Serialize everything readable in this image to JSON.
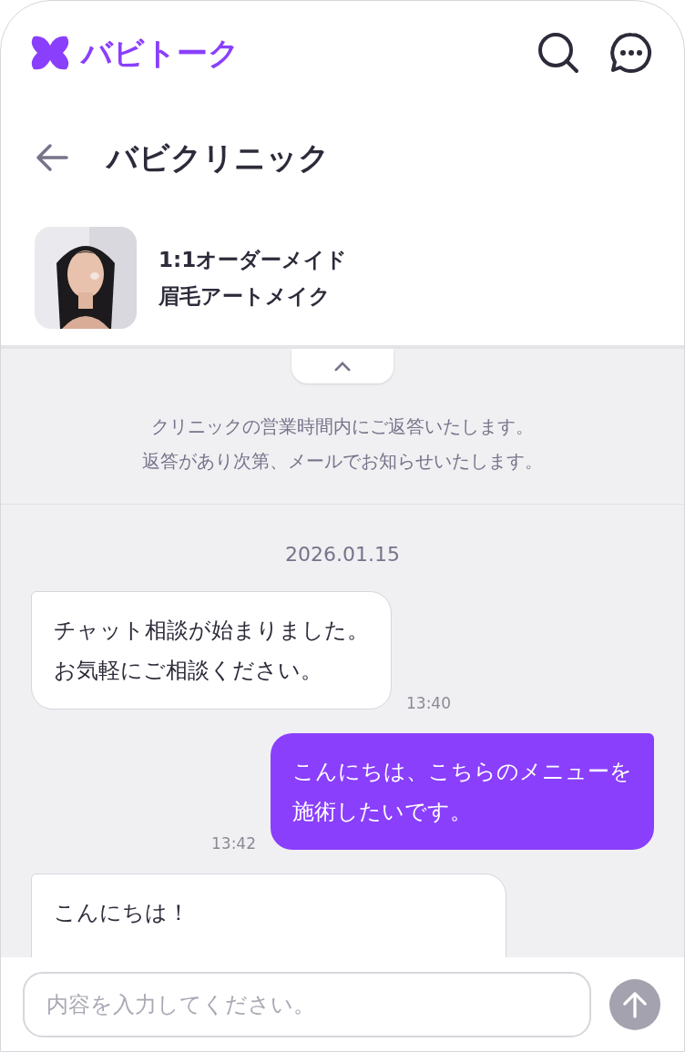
{
  "app": {
    "logo_text": "バビトーク"
  },
  "chat_header": {
    "title": "バビクリニック"
  },
  "product": {
    "image": {
      "kind": "picture"
    },
    "title_lines": [
      "1:1オーダーメイド",
      "眉毛アートメイク"
    ]
  },
  "notice": {
    "lines": [
      "クリニックの営業時間内にご返答いたします。",
      "返答があり次第、メールでお知らせいたします。"
    ]
  },
  "date": "2026.01.15",
  "messages": [
    {
      "kind": "received",
      "lines": [
        "チャット相談が始まりました。",
        "お気軽にご相談ください。"
      ],
      "time": "13:40"
    },
    {
      "kind": "sent",
      "lines": [
        "こんにちは、こちらのメニューを",
        "施術したいです。"
      ],
      "time": "13:42"
    },
    {
      "kind": "received",
      "lines": [
        "こんにちは！"
      ]
    }
  ],
  "composer": {
    "placeholder": "内容を入力してください。",
    "send_disabled": true
  }
}
